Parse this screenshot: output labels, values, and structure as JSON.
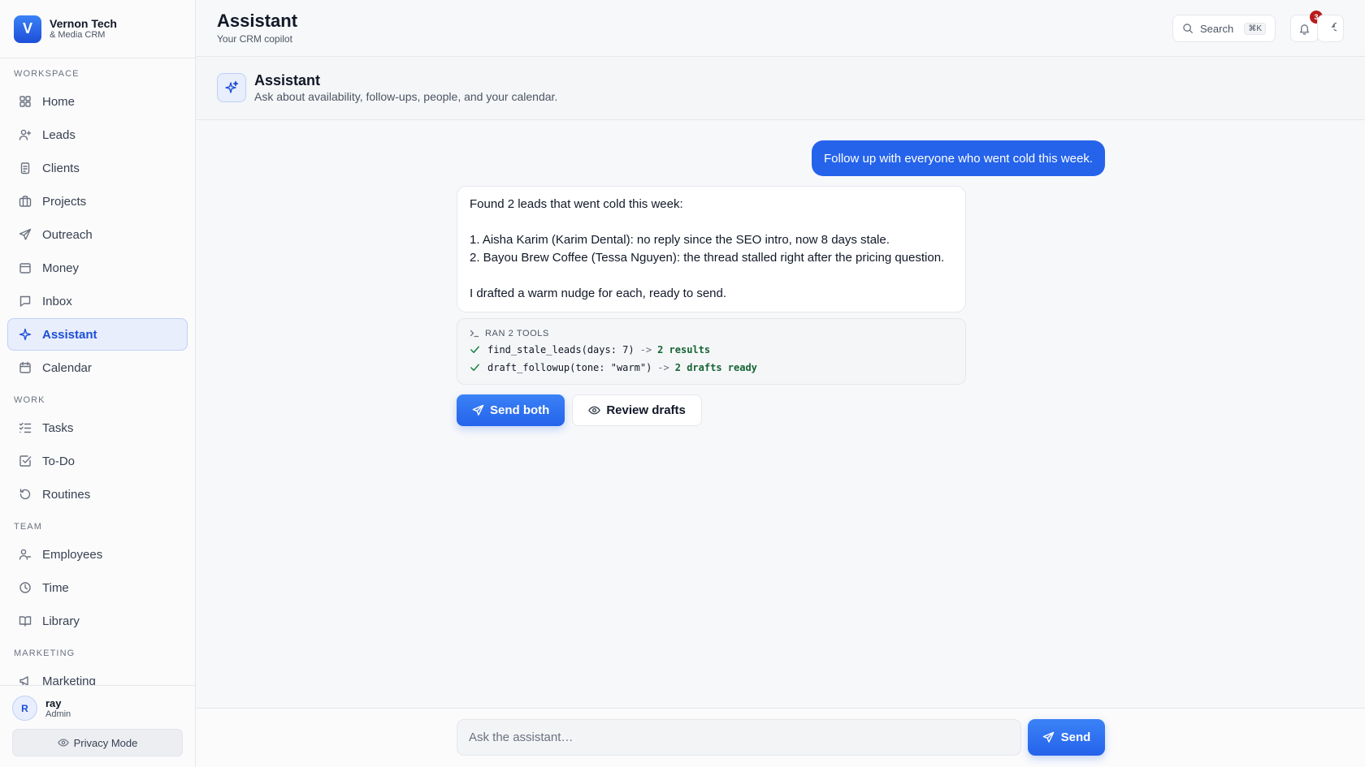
{
  "brand": {
    "initial": "V",
    "name": "Vernon Tech",
    "subtitle": "& Media CRM"
  },
  "sidebar": {
    "sections": [
      {
        "label": "WORKSPACE",
        "items": [
          {
            "label": "Home",
            "icon": "grid-icon"
          },
          {
            "label": "Leads",
            "icon": "user-plus-icon"
          },
          {
            "label": "Clients",
            "icon": "clipboard-icon"
          },
          {
            "label": "Projects",
            "icon": "briefcase-icon"
          },
          {
            "label": "Outreach",
            "icon": "send-icon"
          },
          {
            "label": "Money",
            "icon": "wallet-icon"
          },
          {
            "label": "Inbox",
            "icon": "message-square-icon"
          },
          {
            "label": "Assistant",
            "icon": "sparkle-icon",
            "active": true
          },
          {
            "label": "Calendar",
            "icon": "calendar-icon"
          }
        ]
      },
      {
        "label": "WORK",
        "items": [
          {
            "label": "Tasks",
            "icon": "list-checks-icon"
          },
          {
            "label": "To-Do",
            "icon": "check-square-icon"
          },
          {
            "label": "Routines",
            "icon": "rotate-ccw-icon"
          }
        ]
      },
      {
        "label": "TEAM",
        "items": [
          {
            "label": "Employees",
            "icon": "users-icon"
          },
          {
            "label": "Time",
            "icon": "clock-icon"
          },
          {
            "label": "Library",
            "icon": "book-open-icon"
          }
        ]
      },
      {
        "label": "MARKETING",
        "items": [
          {
            "label": "Marketing",
            "icon": "megaphone-icon"
          }
        ]
      }
    ]
  },
  "user": {
    "initial": "R",
    "name": "ray",
    "role": "Admin"
  },
  "privacy": {
    "label": "Privacy Mode"
  },
  "header": {
    "title": "Assistant",
    "subtitle": "Your CRM copilot",
    "search_label": "Search",
    "search_shortcut": "⌘K",
    "notification_count": "3"
  },
  "subheader": {
    "title": "Assistant",
    "description": "Ask about availability, follow-ups, people, and your calendar."
  },
  "chat": {
    "user_message": "Follow up with everyone who went cold this week.",
    "assistant_lines": [
      "Found 2 leads that went cold this week:",
      "",
      "1. Aisha Karim (Karim Dental): no reply since the SEO intro, now 8 days stale.",
      "2. Bayou Brew Coffee (Tessa Nguyen): the thread stalled right after the pricing question.",
      "",
      "I drafted a warm nudge for each, ready to send."
    ],
    "tools": {
      "header": "RAN 2 TOOLS",
      "calls": [
        {
          "call": "find_stale_leads(days: 7)",
          "arrow": "->",
          "result": "2 results"
        },
        {
          "call": "draft_followup(tone: \"warm\")",
          "arrow": "->",
          "result": "2 drafts ready"
        }
      ]
    },
    "actions": {
      "primary": "Send both",
      "secondary": "Review drafts"
    }
  },
  "composer": {
    "placeholder": "Ask the assistant…",
    "send_label": "Send"
  },
  "colors": {
    "accent": "#2563eb",
    "success": "#15803d",
    "badge": "#b91c1c"
  }
}
